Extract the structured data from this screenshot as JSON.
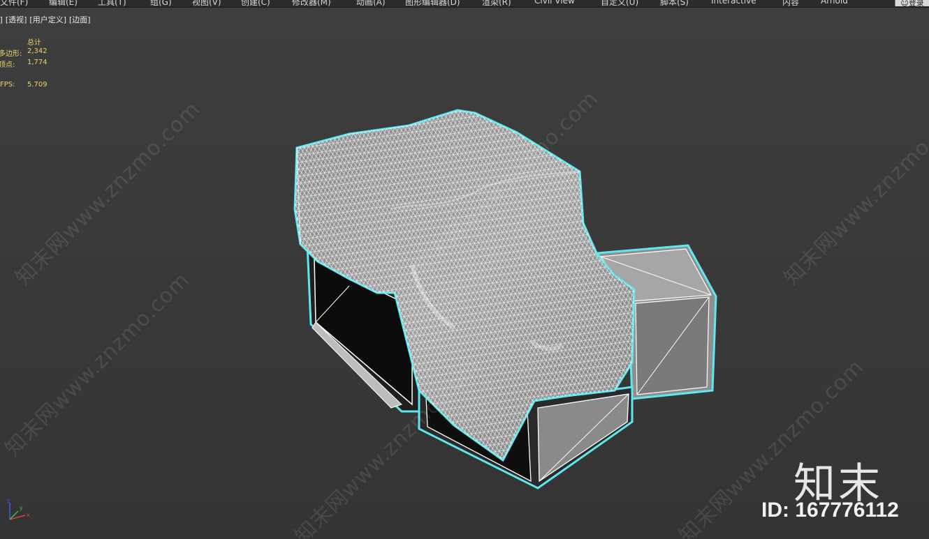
{
  "menubar": {
    "items": [
      "文件(F)",
      "编辑(E)",
      "工具(T)",
      "组(G)",
      "视图(V)",
      "创建(C)",
      "修改器(M)",
      "动画(A)",
      "图形编辑器(D)",
      "渲染(R)",
      "Civil View",
      "自定义(U)",
      "脚本(S)",
      "Interactive",
      "内容",
      "Arnold"
    ],
    "login_label": "登录"
  },
  "viewport": {
    "labels": [
      "[+]",
      "[透视]",
      "[用户定义]",
      "[边面]"
    ]
  },
  "stats": {
    "header": "总计",
    "polygons_label": "多边形:",
    "polygons_value": "2,342",
    "vertices_label": "顶点:",
    "vertices_value": "1,774",
    "fps_label": "FPS:",
    "fps_value": "5.709"
  },
  "watermark": {
    "text": "知末网www.znzmo.com",
    "brand": "知末",
    "id_text": "ID: 167776112"
  },
  "gizmo": {
    "axis_x": "x",
    "axis_y": "y",
    "axis_z": "z"
  },
  "colors": {
    "selection_outline": "#5fe7f0",
    "stats_text": "#e9d468",
    "viewport_bg": "#3a3a3a"
  }
}
